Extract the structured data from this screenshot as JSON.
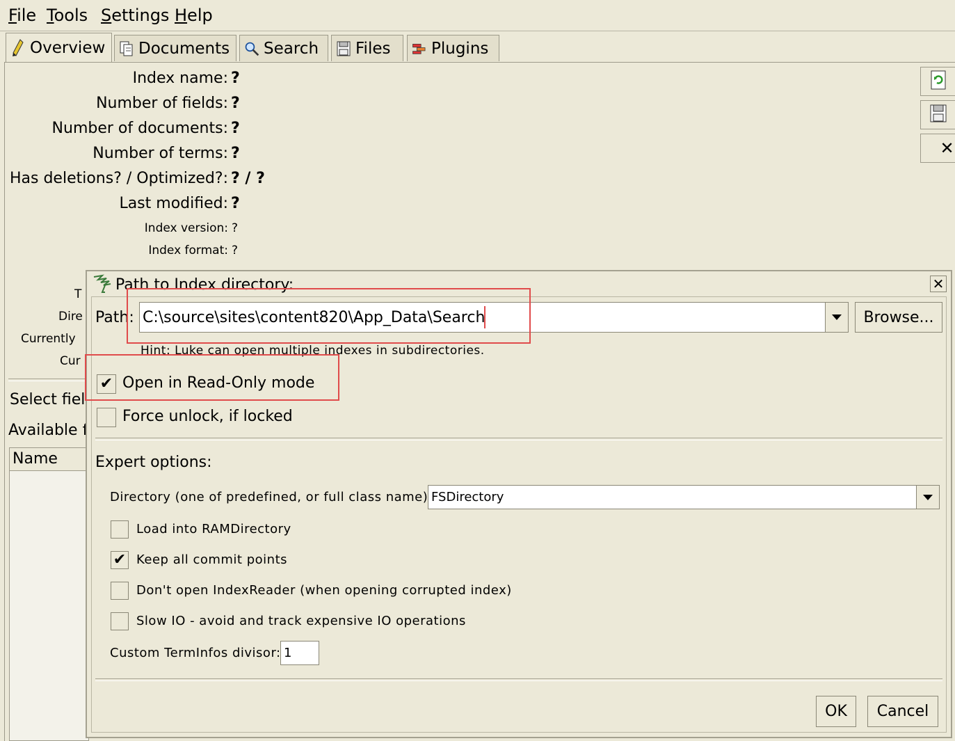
{
  "menu": {
    "items": [
      {
        "label": "File",
        "mnemonic": "F",
        "rest": "ile"
      },
      {
        "label": "Tools",
        "mnemonic": "T",
        "rest": "ools"
      },
      {
        "label": "Settings",
        "mnemonic": "S",
        "rest": "ettings"
      },
      {
        "label": "Help",
        "mnemonic": "H",
        "rest": "elp"
      }
    ]
  },
  "tabs": [
    {
      "label": "Overview",
      "icon": "pencil-icon"
    },
    {
      "label": "Documents",
      "icon": "documents-icon"
    },
    {
      "label": "Search",
      "icon": "search-icon"
    },
    {
      "label": "Files",
      "icon": "files-icon"
    },
    {
      "label": "Plugins",
      "icon": "plugins-icon"
    }
  ],
  "overview": {
    "index_name": {
      "label": "Index name:",
      "value": "?"
    },
    "num_fields": {
      "label": "Number of fields:",
      "value": "?"
    },
    "num_docs": {
      "label": "Number of documents:",
      "value": "?"
    },
    "num_terms": {
      "label": "Number of terms:",
      "value": "?"
    },
    "deletions": {
      "label": "Has deletions? / Optimized?:",
      "value": "? / ?"
    },
    "last_modified": {
      "label": "Last modified:",
      "value": "?"
    },
    "index_version": {
      "label": "Index version:",
      "value": "?"
    },
    "index_format": {
      "label": "Index format:",
      "value": "?"
    },
    "partial_t": "T",
    "partial_dire": "Dire",
    "partial_currently": "Currently",
    "partial_cur": "Cur",
    "select_fields": "Select fiel",
    "available": "Available f",
    "name_header": "Name"
  },
  "dialog": {
    "title": "Path to Index directory:",
    "path_label": "Path:",
    "path_value": "C:\\source\\sites\\content820\\App_Data\\Search",
    "browse": "Browse...",
    "hint": "Hint: Luke can open multiple indexes in subdirectories.",
    "readonly": {
      "label": "Open in Read-Only mode",
      "checked": true
    },
    "force_unlock": {
      "label": "Force unlock, if locked",
      "checked": false
    },
    "expert_options": "Expert options:",
    "directory_label": "Directory (one of predefined, or full class name):",
    "directory_value": "FSDirectory",
    "load_ram": {
      "label": "Load into RAMDirectory",
      "checked": false
    },
    "keep_commits": {
      "label": "Keep all commit points",
      "checked": true
    },
    "dont_open": {
      "label": "Don't open IndexReader (when opening corrupted index)",
      "checked": false
    },
    "slow_io": {
      "label": "Slow IO - avoid and track expensive IO operations",
      "checked": false
    },
    "terminfos_label": "Custom TermInfos divisor:",
    "terminfos_value": "1",
    "ok": "OK",
    "cancel": "Cancel"
  },
  "colors": {
    "background": "#ece9d8",
    "highlight": "#e04b4b"
  }
}
